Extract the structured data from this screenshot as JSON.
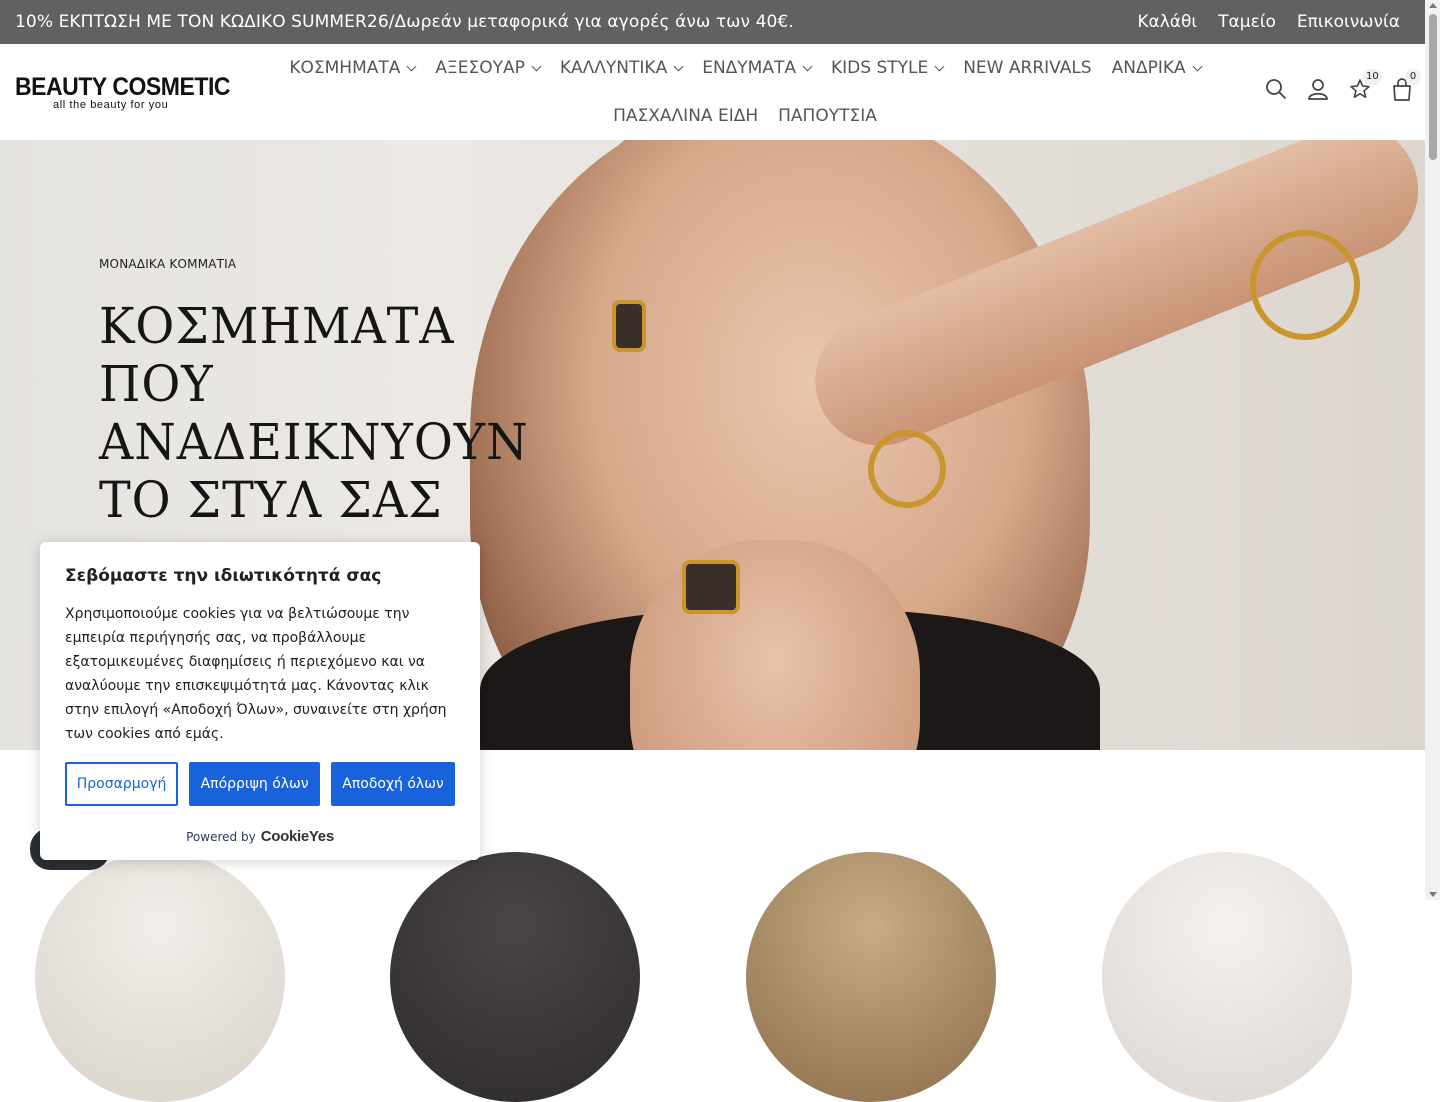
{
  "topbar": {
    "promo": "10% ΕΚΠΤΩΣΗ ΜΕ ΤΟΝ ΚΩΔΙΚΟ SUMMER26/Δωρεάν μεταφορικά για αγορές άνω των 40€.",
    "links": [
      "Καλάθι",
      "Ταμείο",
      "Επικοινωνία"
    ]
  },
  "logo": {
    "brand": "BEAUTY COSMETIC",
    "tagline": "all the beauty for you"
  },
  "nav": {
    "row1": [
      {
        "label": "ΚΟΣΜΗΜΑΤΑ",
        "dropdown": true
      },
      {
        "label": "ΑΞΕΣΟΥΑΡ",
        "dropdown": true
      },
      {
        "label": "ΚΑΛΛΥΝΤΙΚΑ",
        "dropdown": true
      },
      {
        "label": "ΕΝΔΥΜΑΤΑ",
        "dropdown": true
      },
      {
        "label": "KIDS STYLE",
        "dropdown": true
      },
      {
        "label": "NEW ARRIVALS",
        "dropdown": false
      },
      {
        "label": "ΑΝΔΡΙΚΑ",
        "dropdown": true
      }
    ],
    "row2": [
      {
        "label": "ΠΑΣΧΑΛΙΝΑ ΕΙΔΗ",
        "dropdown": false
      },
      {
        "label": "ΠΑΠΟΥΤΣΙΑ",
        "dropdown": false
      }
    ]
  },
  "header_icons": {
    "search": "search-icon",
    "account": "user-icon",
    "wishlist": "star-icon",
    "wishlist_count": "10",
    "cart": "bag-icon",
    "cart_count": "0"
  },
  "hero": {
    "eyebrow": "ΜΟΝΑΔΙΚΑ ΚΟΜΜΑΤΙΑ",
    "title": "ΚΟΣΜΗΜΑΤΑ ΠΟΥ\nΑΝΑΔΕΙΚΝΥΟΥΝ\nΤΟ ΣΤΥΛ ΣΑΣ"
  },
  "cookie": {
    "title": "Σεβόμαστε την ιδιωτικότητά σας",
    "body": "Χρησιμοποιούμε cookies για να βελτιώσουμε την εμπειρία περιήγησής σας, να προβάλλουμε εξατομικευμένες διαφημίσεις ή περιεχόμενο και να αναλύουμε την επισκεψιμότητά μας. Κάνοντας κλικ στην επιλογή «Αποδοχή Όλων», συναινείτε στη χρήση των cookies από εμάς.",
    "customize": "Προσαρμογή",
    "reject": "Απόρριψη όλων",
    "accept": "Αποδοχή όλων",
    "powered_by": "Powered by",
    "powered_brand": "CookieYes"
  },
  "colors": {
    "topbar_bg": "#616161",
    "primary_button": "#1863dc"
  }
}
